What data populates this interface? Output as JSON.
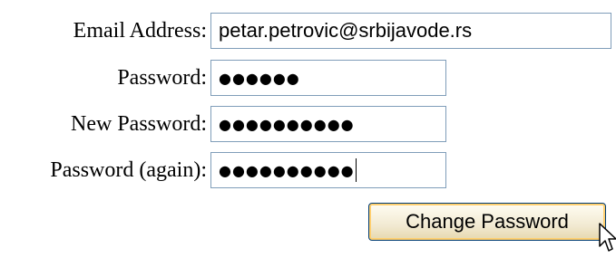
{
  "form": {
    "email": {
      "label": "Email Address:",
      "value": "petar.petrovic@srbijavode.rs"
    },
    "password": {
      "label": "Password:",
      "value": "●●●●●●"
    },
    "new_password": {
      "label": "New Password:",
      "value": "●●●●●●●●●●"
    },
    "password_again": {
      "label": "Password (again):",
      "value": "●●●●●●●●●●"
    },
    "submit_label": "Change Password"
  },
  "icons": {
    "mouse_cursor": "arrow-pointer-icon"
  }
}
